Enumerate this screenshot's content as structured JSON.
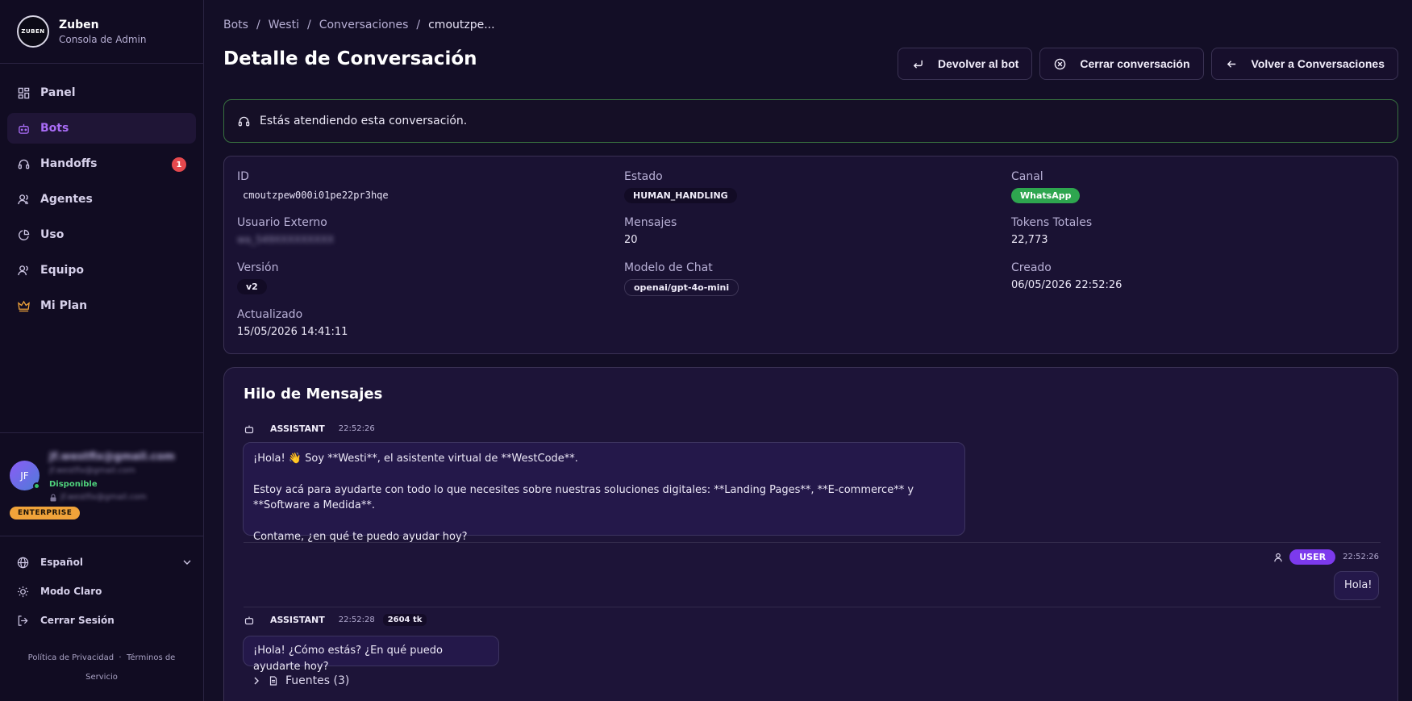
{
  "app": {
    "logo_text": "ZUBEN",
    "name": "Zuben",
    "subtitle": "Consola de Admin"
  },
  "sidebar": {
    "items": [
      {
        "label": "Panel",
        "icon": "dashboard-icon"
      },
      {
        "label": "Bots",
        "icon": "bot-icon",
        "active": true
      },
      {
        "label": "Handoffs",
        "icon": "headset-icon",
        "badge": "1"
      },
      {
        "label": "Agentes",
        "icon": "users-icon"
      },
      {
        "label": "Uso",
        "icon": "pie-chart-icon"
      },
      {
        "label": "Equipo",
        "icon": "team-icon"
      },
      {
        "label": "Mi Plan",
        "icon": "crown-icon"
      }
    ]
  },
  "user": {
    "initials": "JF",
    "email": "jf.westfix@gmail.com",
    "secondary_email": "jf.westfix@gmail.com",
    "status": "Disponible",
    "locked_email": "jf.westfix@gmail.com",
    "plan": "ENTERPRISE"
  },
  "settings": {
    "language": "Español",
    "theme_toggle": "Modo Claro",
    "logout": "Cerrar Sesión"
  },
  "footer": {
    "privacy": "Política de Privacidad",
    "separator": "·",
    "terms": "Términos de Servicio"
  },
  "breadcrumb": {
    "items": [
      "Bots",
      "Westi",
      "Conversaciones"
    ],
    "separator": "/",
    "current": "cmoutzpe..."
  },
  "page": {
    "title": "Detalle de Conversación"
  },
  "actions": {
    "return_to_bot": "Devolver al bot",
    "close_conversation": "Cerrar conversación",
    "back": "Volver a Conversaciones"
  },
  "notice": {
    "text": "Estás atendiendo esta conversación."
  },
  "details": {
    "id": {
      "label": "ID",
      "value": "cmoutzpew000i01pe22pr3hqe"
    },
    "estado": {
      "label": "Estado",
      "value": "HUMAN_HANDLING"
    },
    "canal": {
      "label": "Canal",
      "value": "WhatsApp"
    },
    "usuario_externo": {
      "label": "Usuario Externo",
      "value": "wa_549XXXXXXXXX"
    },
    "mensajes": {
      "label": "Mensajes",
      "value": "20"
    },
    "tokens": {
      "label": "Tokens Totales",
      "value": "22,773"
    },
    "version": {
      "label": "Versión",
      "value": "v2"
    },
    "modelo": {
      "label": "Modelo de Chat",
      "value": "openai/gpt-4o-mini"
    },
    "creado": {
      "label": "Creado",
      "value": "06/05/2026 22:52:26"
    },
    "actualizado": {
      "label": "Actualizado",
      "value": "15/05/2026 14:41:11"
    }
  },
  "thread": {
    "title": "Hilo de Mensajes",
    "messages": [
      {
        "role": "ASSISTANT",
        "time": "22:52:26",
        "lines": [
          "¡Hola! 👋 Soy **Westi**, el asistente virtual de **WestCode**.",
          "Estoy acá para ayudarte con todo lo que necesites sobre nuestras soluciones digitales: **Landing Pages**, **E-commerce** y **Software a Medida**.",
          "Contame, ¿en qué te puedo ayudar hoy?"
        ]
      },
      {
        "role": "USER",
        "time": "22:52:26",
        "text": "Hola!"
      },
      {
        "role": "ASSISTANT",
        "time": "22:52:28",
        "tokens": "2604 tk",
        "text": "¡Hola! ¿Cómo estás? ¿En qué puedo ayudarte hoy?",
        "sources": "Fuentes (3)"
      }
    ]
  },
  "colors": {
    "accent": "#a96cf6",
    "user_pill": "#7c3aed",
    "success": "#2ea64f",
    "badge": "#e5484d",
    "plan": "#f0a33a"
  }
}
